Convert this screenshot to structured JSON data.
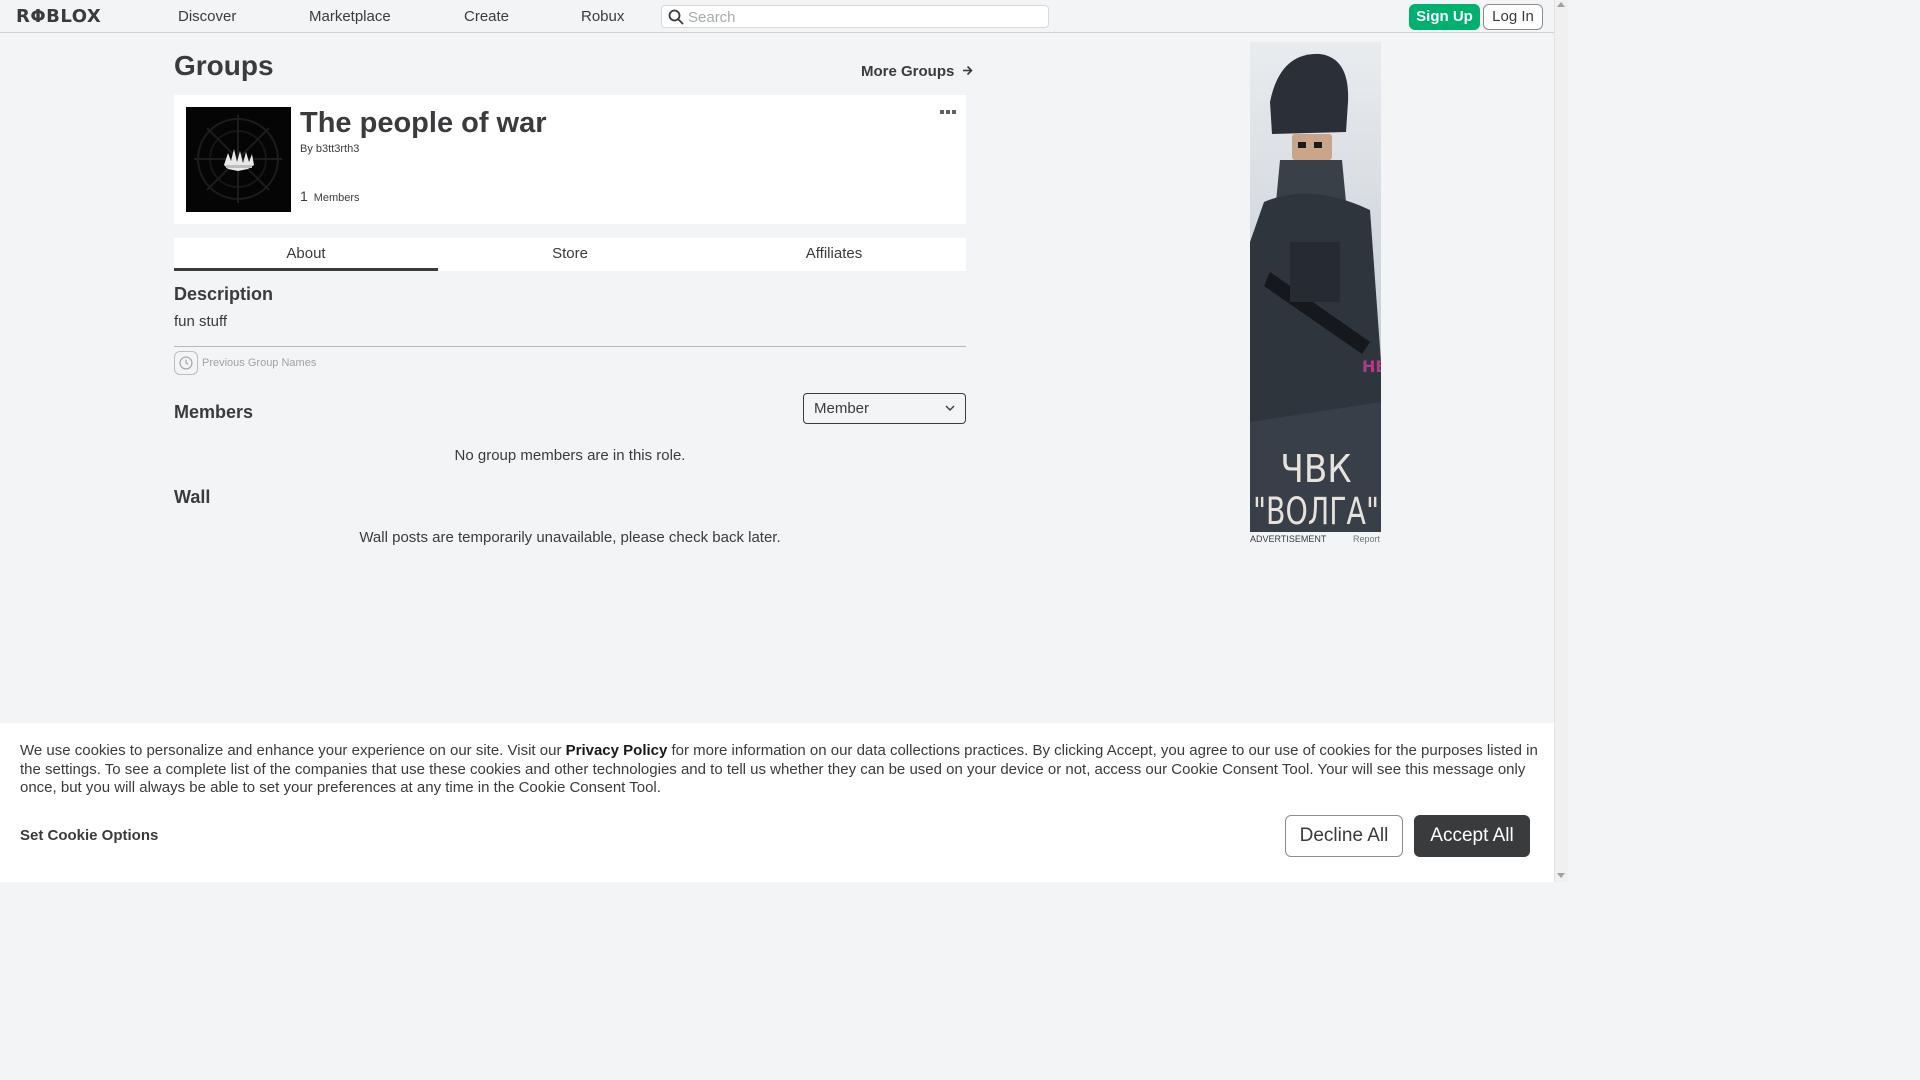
{
  "nav": {
    "logo": "RΦBLOX",
    "links": [
      "Discover",
      "Marketplace",
      "Create",
      "Robux"
    ],
    "search_placeholder": "Search",
    "sign_up": "Sign Up",
    "log_in": "Log In"
  },
  "page": {
    "title": "Groups",
    "more_groups": "More Groups"
  },
  "group": {
    "name": "The people of war",
    "by_label": "By",
    "owner": "b3tt3rth3",
    "member_count": "1",
    "members_label": "Members"
  },
  "tabs": [
    "About",
    "Store",
    "Affiliates"
  ],
  "about": {
    "description_title": "Description",
    "description": "fun stuff",
    "previous_names": "Previous Group Names",
    "members_title": "Members",
    "role_selected": "Member",
    "no_members": "No group members are in this role.",
    "wall_title": "Wall",
    "wall_unavailable": "Wall posts are temporarily unavailable, please check back later."
  },
  "ad": {
    "caption": "ADVERTISEMENT",
    "report": "Report",
    "art_text_line1": "ЧВК",
    "art_text_line2": "\"ВОЛГА\""
  },
  "cookie": {
    "text_before_link": "We use cookies to personalize and enhance your experience on our site. Visit our ",
    "privacy_link": "Privacy Policy",
    "text_after_link": " for more information on our data collections practices. By clicking Accept, you agree to our use of cookies for the purposes listed in the settings. To see a complete list of the companies that use these cookies and other technologies and to tell us whether they can be used on your device or not, access our Cookie Consent Tool. Your will see this message only once, but you will always be able to set your preferences at any time in the Cookie Consent Tool.",
    "set_options": "Set Cookie Options",
    "decline": "Decline All",
    "accept": "Accept All"
  },
  "colors": {
    "sign_up_bg": "#00b06f",
    "page_bg": "#f2f4f5",
    "text": "#393b3d"
  }
}
